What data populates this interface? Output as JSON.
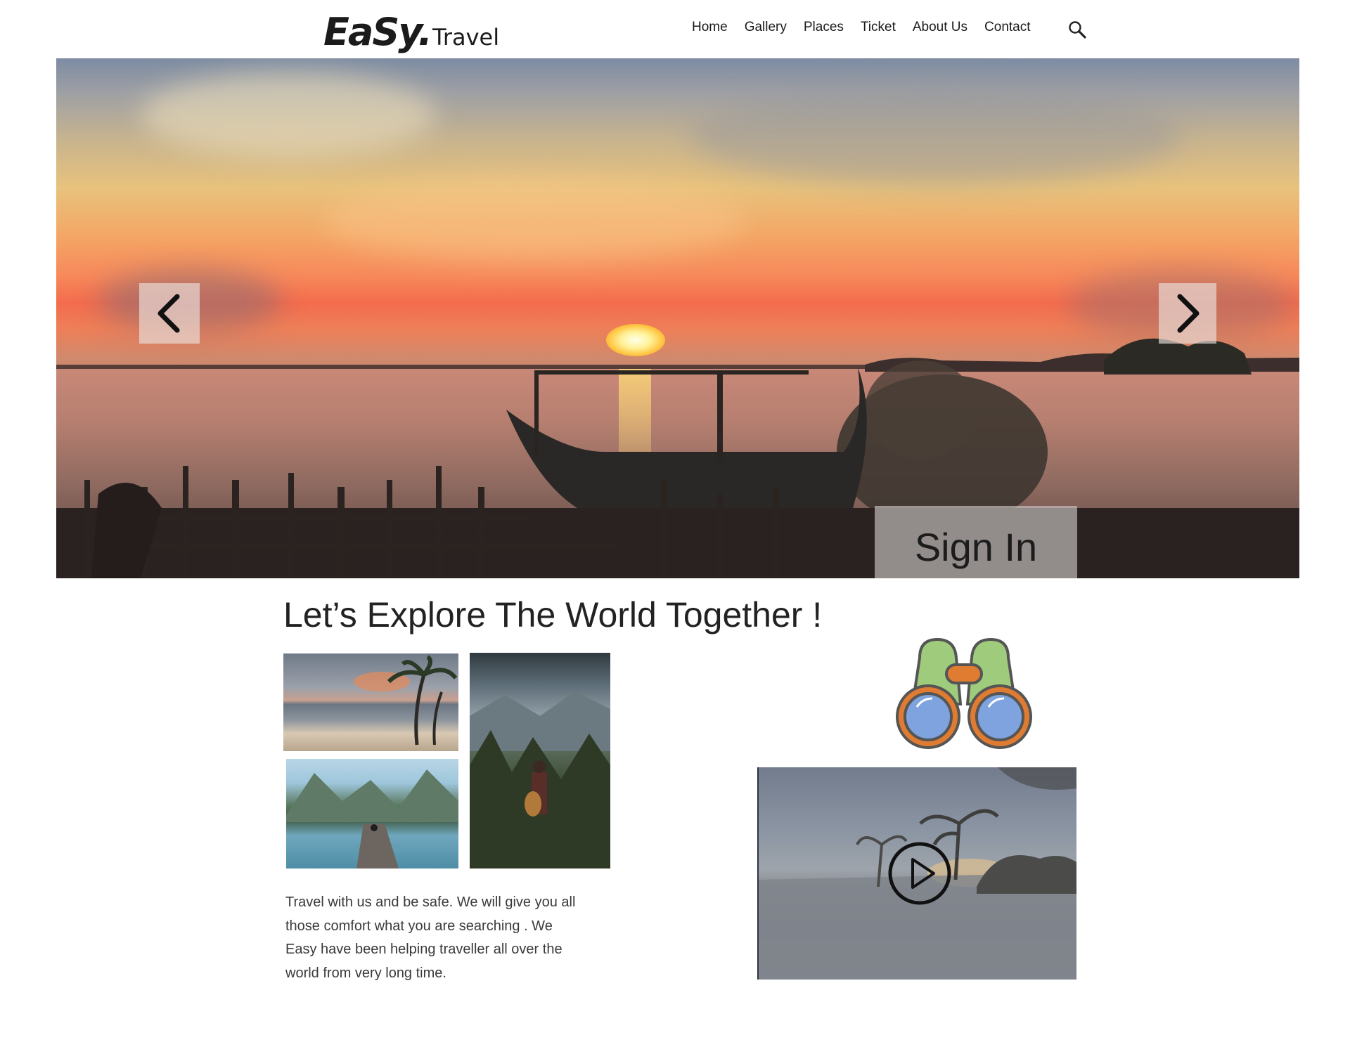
{
  "header": {
    "logo_main": "EaSy.",
    "logo_sub": "Travel",
    "nav": [
      "Home",
      "Gallery",
      "Places",
      "Ticket",
      "About Us",
      "Contact"
    ],
    "search_icon": "search-icon"
  },
  "hero": {
    "prev_icon": "chevron-left-icon",
    "next_icon": "chevron-right-icon",
    "signin_label": "Sign In"
  },
  "main": {
    "title": "Let’s Explore The World Together !",
    "description": "Travel with us and be safe. We will  give you all those comfort what you are searching . We Easy have been helping traveller all over the world from very long time.",
    "binoculars_icon": "binoculars-icon",
    "play_icon": "play-icon"
  }
}
